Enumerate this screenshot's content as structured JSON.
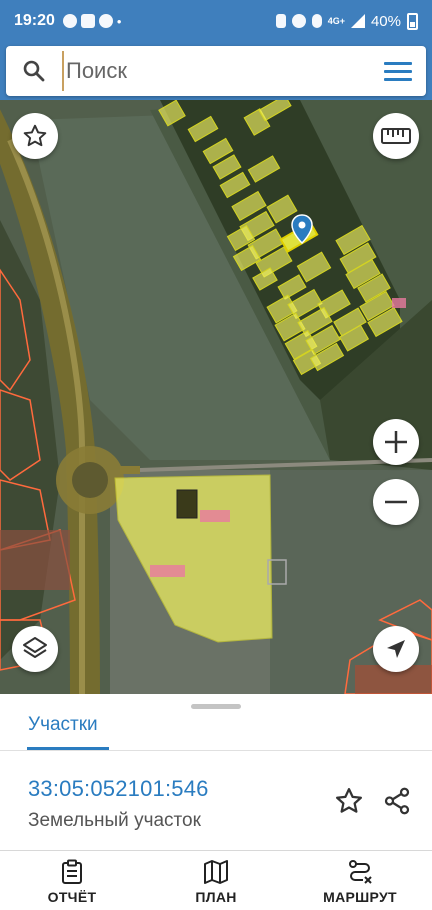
{
  "status_bar": {
    "time": "19:20",
    "network": "4G+",
    "battery": "40%"
  },
  "search": {
    "placeholder": "Поиск"
  },
  "map": {
    "buttons": [
      "favorites",
      "ruler",
      "zoom-in",
      "zoom-out",
      "layers",
      "my-location"
    ]
  },
  "sheet": {
    "tab_label": "Участки",
    "cadastral_number": "33:05:052101:546",
    "parcel_type": "Земельный участок"
  },
  "bottom_nav": {
    "report": "ОТЧЁТ",
    "plan": "ПЛАН",
    "route": "МАРШРУТ"
  },
  "colors": {
    "primary": "#3f7fbd",
    "accent": "#2a7cc0",
    "parcel_fill": "#f0f060",
    "boundary": "#ff6a3d"
  }
}
